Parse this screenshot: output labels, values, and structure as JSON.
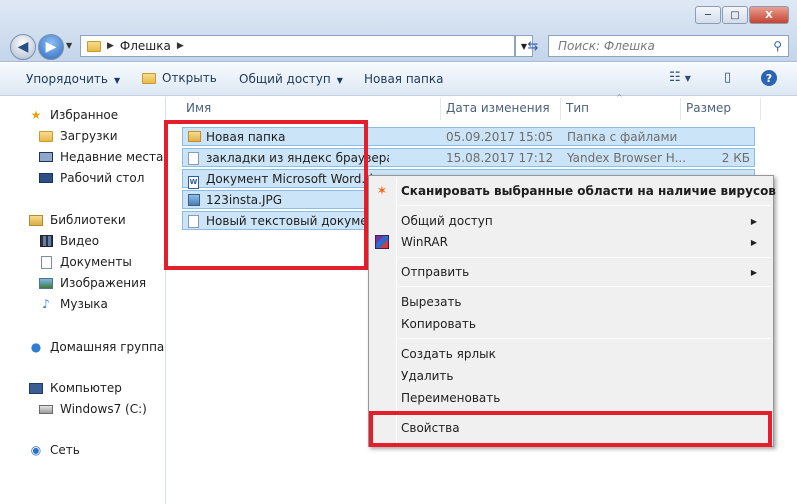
{
  "window": {
    "minimize_label": "─",
    "maximize_label": "□",
    "close_label": "X"
  },
  "address": {
    "path": [
      "Флешка"
    ],
    "search_placeholder": "Поиск: Флешка"
  },
  "toolbar": {
    "organize": "Упорядочить",
    "open": "Открыть",
    "share": "Общий доступ",
    "new_folder": "Новая папка"
  },
  "sidebar": {
    "favorites": "Избранное",
    "downloads": "Загрузки",
    "recent": "Недавние места",
    "desktop": "Рабочий стол",
    "libraries": "Библиотеки",
    "video": "Видео",
    "documents": "Документы",
    "images": "Изображения",
    "music": "Музыка",
    "homegroup": "Домашняя группа",
    "computer": "Компьютер",
    "drive_c": "Windows7 (C:)",
    "network": "Сеть"
  },
  "columns": {
    "name": "Имя",
    "date": "Дата изменения",
    "type": "Тип",
    "size": "Размер"
  },
  "files": [
    {
      "name": "Новая папка",
      "date": "05.09.2017 15:05",
      "type": "Папка с файлами",
      "size": "",
      "icon": "folder-icon"
    },
    {
      "name": "закладки из яндекс браузера.html",
      "date": "15.08.2017 17:12",
      "type": "Yandex Browser H...",
      "size": "2 КБ",
      "icon": "html-file-icon"
    },
    {
      "name": "Документ Microsoft Word.docx",
      "date": "",
      "type": "",
      "size": "",
      "icon": "word-document-icon"
    },
    {
      "name": "123insta.JPG",
      "date": "",
      "type": "",
      "size": "",
      "icon": "image-file-icon"
    },
    {
      "name": "Новый текстовый документ.txt",
      "date": "",
      "type": "",
      "size": "",
      "icon": "text-file-icon"
    }
  ],
  "context_menu": {
    "scan": "Сканировать выбранные области на наличие вирусов",
    "share": "Общий доступ",
    "winrar": "WinRAR",
    "send_to": "Отправить",
    "cut": "Вырезать",
    "copy": "Копировать",
    "create_shortcut": "Создать ярлык",
    "delete": "Удалить",
    "rename": "Переименовать",
    "properties": "Свойства"
  },
  "colors": {
    "highlight_red": "#e51e2b",
    "selection": "#cce4f7"
  }
}
